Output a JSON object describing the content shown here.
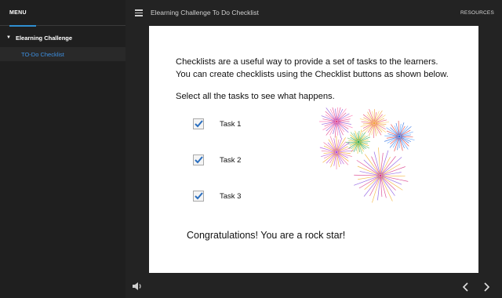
{
  "sidebar": {
    "menu_label": "MENU",
    "section_label": "Elearning Challenge",
    "items": [
      {
        "label": "TO-Do Checklist",
        "selected": true
      }
    ],
    "accent_color": "#2f8fd1",
    "selected_item_color": "#3d8fe0"
  },
  "header": {
    "menu_icon": "hamburger-icon",
    "title": "Elearning Challenge To Do Checklist",
    "resources_label": "RESOURCES"
  },
  "slide": {
    "intro_line1": "Checklists are a useful way to provide a set of tasks to the learners.",
    "intro_line2": "You can create checklists using the Checklist buttons as shown below.",
    "instruction": "Select all the tasks to see what happens.",
    "tasks": [
      {
        "label": "Task 1",
        "checked": true
      },
      {
        "label": "Task 2",
        "checked": true
      },
      {
        "label": "Task 3",
        "checked": true
      }
    ],
    "decoration": "fireworks-image",
    "congrats": "Congratulations! You are a rock star!",
    "check_color": "#2b6fbf"
  },
  "footer": {
    "volume_icon": "volume-icon",
    "prev_icon": "chevron-left-icon",
    "next_icon": "chevron-right-icon"
  }
}
